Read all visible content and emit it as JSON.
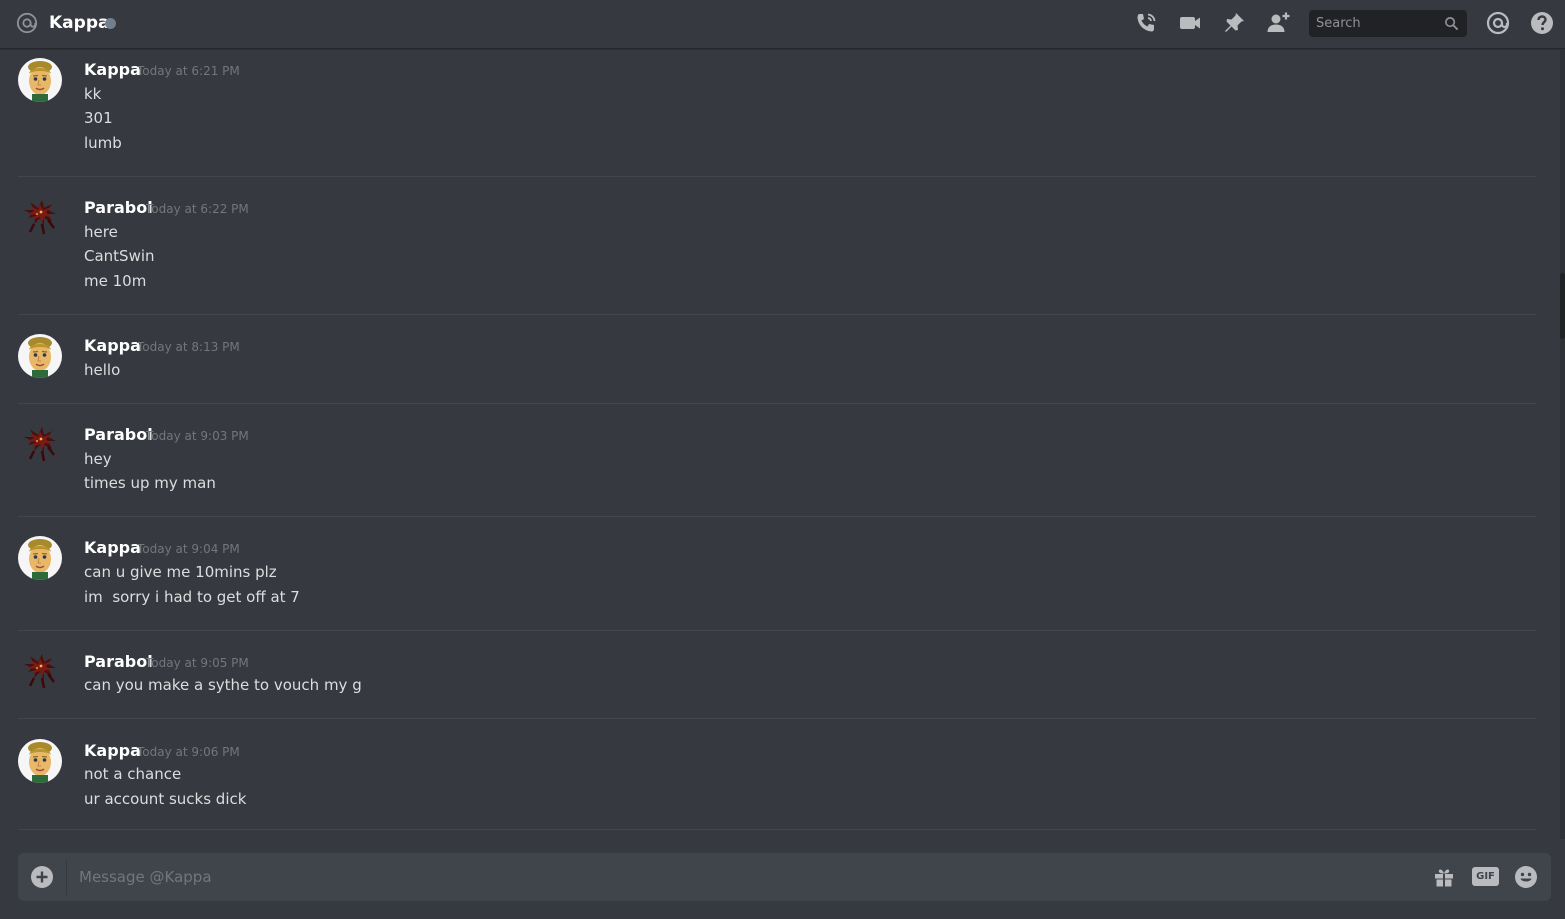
{
  "header": {
    "channel_name": "Kappa",
    "search_placeholder": "Search",
    "icons": [
      "at-icon",
      "call-icon",
      "video-icon",
      "pin-icon",
      "add-friend-icon",
      "search-icon",
      "mention-icon",
      "help-icon"
    ]
  },
  "messages": [
    {
      "author": "Kappa",
      "timestamp": "Today at 6:21 PM",
      "avatar": "kappa-avatar",
      "lines": [
        "kk",
        "301",
        "lumb"
      ]
    },
    {
      "author": "Parabol",
      "timestamp": "Today at 6:22 PM",
      "avatar": "parabol-avatar",
      "lines": [
        "here",
        "CantSwin",
        "me 10m"
      ]
    },
    {
      "author": "Kappa",
      "timestamp": "Today at 8:13 PM",
      "avatar": "kappa-avatar",
      "lines": [
        "hello"
      ]
    },
    {
      "author": "Parabol",
      "timestamp": "Today at 9:03 PM",
      "avatar": "parabol-avatar",
      "lines": [
        "hey",
        "times up my man"
      ]
    },
    {
      "author": "Kappa",
      "timestamp": "Today at 9:04 PM",
      "avatar": "kappa-avatar",
      "lines": [
        "can u give me 10mins plz",
        "im  sorry i had to get off at 7"
      ]
    },
    {
      "author": "Parabol",
      "timestamp": "Today at 9:05 PM",
      "avatar": "parabol-avatar",
      "lines": [
        "can you make a sythe to vouch my g"
      ]
    },
    {
      "author": "Kappa",
      "timestamp": "Today at 9:06 PM",
      "avatar": "kappa-avatar",
      "lines": [
        "not a chance",
        "ur account sucks dick"
      ]
    }
  ],
  "composer": {
    "placeholder": "Message @Kappa",
    "gif_label": "GIF"
  },
  "colors": {
    "background": "#36393f",
    "header_text": "#ffffff",
    "timestamp": "#72767d",
    "message_text": "#dcddde",
    "composer_bg": "#40444b",
    "search_bg": "#202225",
    "icon": "#b9bbbe"
  }
}
